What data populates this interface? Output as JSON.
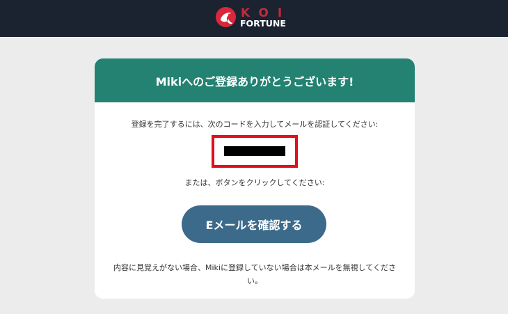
{
  "header": {
    "logo_top": "KOI",
    "logo_bottom": "FORTUNE",
    "bg_color": "#1b2230"
  },
  "card": {
    "title": "Mikiへのご登録ありがとうございます!",
    "header_color": "#238271",
    "instruction": "登録を完了するには、次のコードを入力してメールを認証してください:",
    "code_redacted": true,
    "or_text": "または、ボタンをクリックしてください:",
    "verify_button_label": "Eメールを確認する",
    "button_color": "#3c6a8a",
    "footer_note": "内容に見覚えがない場合、Mikiに登録していない場合は本メールを無視してください。",
    "highlight_color": "#e0101a"
  }
}
